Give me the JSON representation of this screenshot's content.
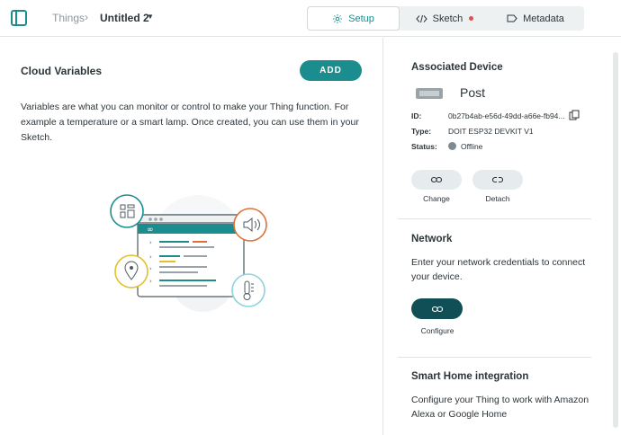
{
  "header": {
    "breadcrumb_root": "Things",
    "breadcrumb_sep": "›",
    "thing_name": "Untitled 2",
    "tabs": [
      {
        "label": "Setup",
        "icon": "gear-icon",
        "active": true
      },
      {
        "label": "Sketch",
        "icon": "code-icon",
        "active": false,
        "badge_color": "#e04f4f"
      },
      {
        "label": "Metadata",
        "icon": "tag-icon",
        "active": false
      }
    ]
  },
  "cloud_variables": {
    "title": "Cloud Variables",
    "add_label": "ADD",
    "description": "Variables are what you can monitor or control to make your Thing function. For example a temperature or a smart lamp. Once created, you can use them in your Sketch."
  },
  "associated_device": {
    "title": "Associated Device",
    "name": "Post",
    "id_label": "ID:",
    "id_value": "0b27b4ab-e56d-49dd-a66e-fb94...",
    "type_label": "Type:",
    "type_value": "DOIT ESP32 DEVKIT V1",
    "status_label": "Status:",
    "status_value": "Offline",
    "change_label": "Change",
    "detach_label": "Detach"
  },
  "network": {
    "title": "Network",
    "description": "Enter your network credentials to connect your device.",
    "configure_label": "Configure"
  },
  "smart_home": {
    "title": "Smart Home integration",
    "description": "Configure your Thing to work with Amazon Alexa or Google Home"
  },
  "colors": {
    "accent": "#1b8d8f",
    "dark_button": "#114f57",
    "offline": "#7f8a8f"
  }
}
